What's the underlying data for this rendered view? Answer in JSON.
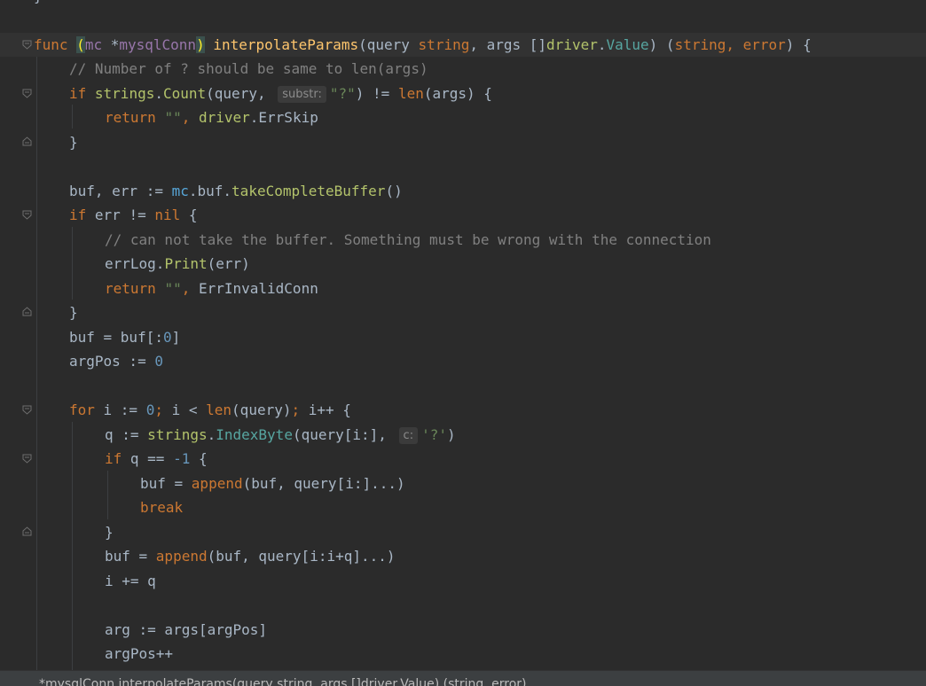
{
  "editor": {
    "lines": {
      "l1": {
        "func_kw": "func ",
        "receiver_open": "(",
        "receiver_name": "mc ",
        "receiver_star": "*",
        "receiver_type": "mysqlConn",
        "receiver_close": ")",
        "space": " ",
        "func_name": "interpolateParams",
        "params": "(query ",
        "t_string": "string",
        "sep1": ", args []",
        "pkg_driver": "driver",
        "dot_value": ".",
        "t_value": "Value",
        "close_params": ") (",
        "r_string": "string",
        "sep2": ", ",
        "r_error": "error",
        "end": ") {"
      },
      "l2": {
        "comment": "// Number of ? should be same to len(args)"
      },
      "l3": {
        "if": "if ",
        "pkg": "strings",
        "dot": ".",
        "fn": "Count",
        "arg": "(query, ",
        "hint": "substr:",
        "str": "\"?\"",
        "mid": ") != ",
        "len": "len",
        "rest": "(args) {"
      },
      "l4": {
        "ret": "return ",
        "str": "\"\"",
        "sep": ", ",
        "pkg": "driver",
        "dot": ".",
        "val": "ErrSkip"
      },
      "l5": {
        "text": "}"
      },
      "l7": {
        "a": "buf, err := ",
        "mc": "mc",
        "dot1": ".",
        "buf": "buf",
        "dot2": ".",
        "fn": "takeCompleteBuffer",
        "end": "()"
      },
      "l8": {
        "if": "if ",
        "a": "err != ",
        "nil": "nil",
        "end": " {"
      },
      "l9": {
        "comment": "// can not take the buffer. Something must be wrong with the connection"
      },
      "l10": {
        "a": "errLog.",
        "fn": "Print",
        "end": "(err)"
      },
      "l11": {
        "ret": "return ",
        "str": "\"\"",
        "sep": ", ",
        "val": "ErrInvalidConn"
      },
      "l12": {
        "text": "}"
      },
      "l13": {
        "a": "buf = buf[:",
        "num": "0",
        "end": "]"
      },
      "l14": {
        "a": "argPos := ",
        "num": "0"
      },
      "l16": {
        "for": "for ",
        "a": "i := ",
        "num": "0",
        "semi1": "; ",
        "b": "i < ",
        "len": "len",
        "c": "(query)",
        "semi2": "; ",
        "d": "i++ {"
      },
      "l17": {
        "a": "q := ",
        "pkg": "strings",
        "dot": ".",
        "fn": "IndexByte",
        "b": "(query[i:], ",
        "hint": "c:",
        "str": "'?'",
        "end": ")"
      },
      "l18": {
        "if": "if ",
        "a": "q == ",
        "num": "-1",
        "end": " {"
      },
      "l19": {
        "a": "buf = ",
        "app": "append",
        "b": "(buf, query[i:]...)"
      },
      "l20": {
        "brk": "break"
      },
      "l21": {
        "text": "}"
      },
      "l22": {
        "a": "buf = ",
        "app": "append",
        "b": "(buf, query[i:i+q]...)"
      },
      "l23": {
        "a": "i += q"
      },
      "l25": {
        "a": "arg := args[argPos]"
      },
      "l26": {
        "a": "argPos++"
      }
    }
  },
  "status_bar": {
    "breadcrumb": "*mysqlConn.interpolateParams(query string, args []driver.Value) (string, error)"
  },
  "colors": {
    "background": "#2b2b2b",
    "keyword": "#cc7832",
    "function": "#ffc66d",
    "comment": "#808080",
    "string": "#6a8759",
    "number": "#6897bb"
  }
}
